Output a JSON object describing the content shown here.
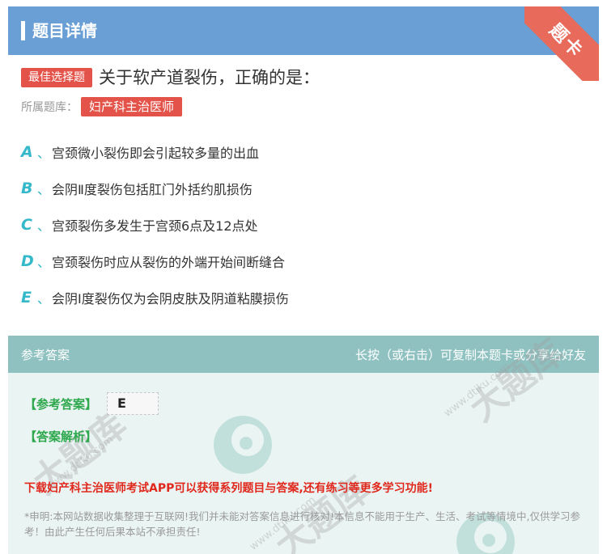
{
  "header": {
    "title": "题目详情",
    "corner_badge": "题卡"
  },
  "question": {
    "type_tag": "最佳选择题",
    "text": "关于软产道裂伤，正确的是：",
    "bank_label": "所属题库：",
    "bank_name": "妇产科主治医师"
  },
  "options": [
    {
      "letter": "A",
      "sep": "、",
      "text": "宫颈微小裂伤即会引起较多量的出血"
    },
    {
      "letter": "B",
      "sep": "、",
      "text": "会阴Ⅱ度裂伤包括肛门外括约肌损伤"
    },
    {
      "letter": "C",
      "sep": "、",
      "text": "宫颈裂伤多发生于宫颈6点及12点处"
    },
    {
      "letter": "D",
      "sep": "、",
      "text": "宫颈裂伤时应从裂伤的外端开始间断缝合"
    },
    {
      "letter": "E",
      "sep": "、",
      "text": "会阴Ⅰ度裂伤仅为会阴皮肤及阴道粘膜损伤"
    }
  ],
  "answer_section": {
    "header_left": "参考答案",
    "header_right": "长按（或右击）可复制本题卡或分享给好友",
    "answer_label": "【参考答案】",
    "answer_value": "E",
    "analysis_label": "【答案解析】",
    "promo": "下载妇产科主治医师考试APP可以获得系列题目与答案,还有练习等更多学习功能!",
    "disclaimer": "*申明:本网站数据收集整理于互联网!我们并未能对答案信息进行核对!本信息不能用于生产、生活、考试等情境中,仅供学习参考！由此产生任何后果本站不承担责任!"
  },
  "watermark": {
    "brand": "大题库",
    "domain": "www.dtiku.com"
  },
  "colors": {
    "header_bg": "#6a9fd5",
    "accent_red": "#e4534a",
    "option_letter": "#35b8c9",
    "answer_green": "#2ea84d",
    "promo_red": "#e0281c"
  }
}
